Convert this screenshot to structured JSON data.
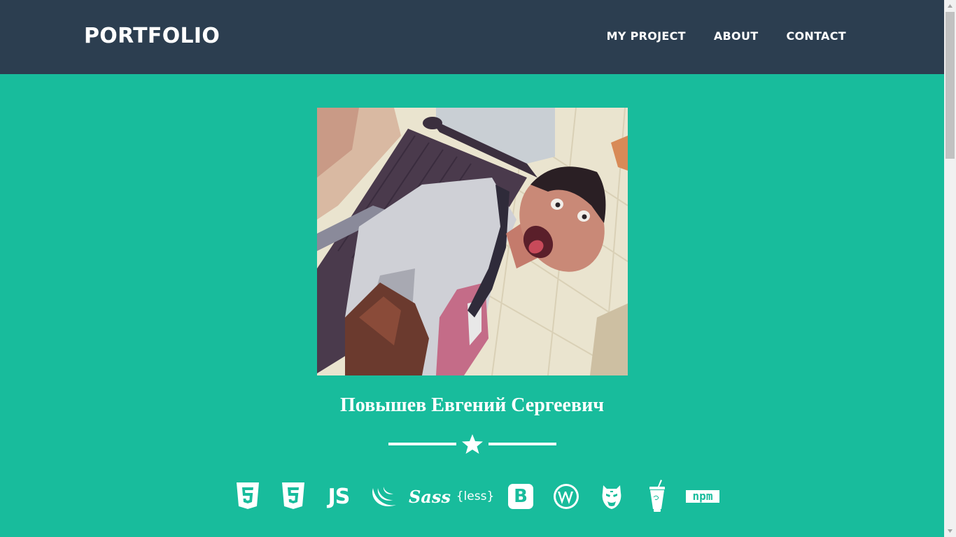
{
  "nav": {
    "brand": "PORTFOLIO",
    "links": [
      "MY PROJECT",
      "ABOUT",
      "CONTACT"
    ]
  },
  "profile": {
    "name": "Повышев Евгений Сергеевич"
  },
  "skills": {
    "js_label": "JS",
    "sass_label": "Sass",
    "less_label": "{less}",
    "bootstrap_label": "B",
    "npm_label": "npm",
    "icons": [
      "html5-icon",
      "css3-icon",
      "javascript-icon",
      "jquery-icon",
      "sass-icon",
      "less-icon",
      "bootstrap-icon",
      "wordpress-icon",
      "grunt-icon",
      "gulp-icon",
      "npm-icon"
    ]
  },
  "colors": {
    "navbar": "#2c3e50",
    "background": "#18bc9c",
    "text": "#ffffff"
  }
}
